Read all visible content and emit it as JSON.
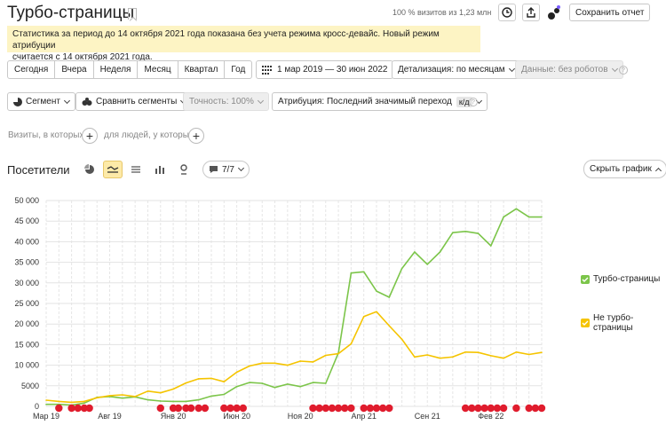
{
  "header": {
    "title": "Турбо-страницы",
    "visits_share": "100 % визитов из 1,23 млн",
    "save_report": "Сохранить отчет"
  },
  "notice": {
    "line1": "Статистика за период до 14 октября 2021 года показана без учета режима кросс-девайс. Новый режим атрибуции",
    "line2": "считается с 14 октября 2021 года."
  },
  "periods": [
    "Сегодня",
    "Вчера",
    "Неделя",
    "Месяц",
    "Квартал",
    "Год"
  ],
  "date_range": "1 мар 2019 — 30 июн 2022",
  "detail": "Детализация: по месяцам",
  "data_filter": "Данные: без роботов",
  "segment": "Сегмент",
  "compare": "Сравнить сегменты",
  "accuracy": "Точность: 100%",
  "attribution": "Атрибуция: Последний значимый переход",
  "attribution_badge": "к/д",
  "visits_who": "Визиты, в которых",
  "people_who": "для людей, у которых",
  "chart_section": {
    "title": "Посетители",
    "metrics_badge": "7/7",
    "hide_chart": "Скрыть график"
  },
  "chart_data": {
    "type": "line",
    "x": [
      "2019-03",
      "2019-04",
      "2019-05",
      "2019-06",
      "2019-07",
      "2019-08",
      "2019-09",
      "2019-10",
      "2019-11",
      "2019-12",
      "2020-01",
      "2020-02",
      "2020-03",
      "2020-04",
      "2020-05",
      "2020-06",
      "2020-07",
      "2020-08",
      "2020-09",
      "2020-10",
      "2020-11",
      "2020-12",
      "2021-01",
      "2021-02",
      "2021-03",
      "2021-04",
      "2021-05",
      "2021-06",
      "2021-07",
      "2021-08",
      "2021-09",
      "2021-10",
      "2021-11",
      "2021-12",
      "2022-01",
      "2022-02",
      "2022-03",
      "2022-04",
      "2022-05",
      "2022-06"
    ],
    "x_ticks": [
      "Мар 19",
      "Авг 19",
      "Янв 20",
      "Июн 20",
      "Ноя 20",
      "Апр 21",
      "Сен 21",
      "Фев 22"
    ],
    "y_ticks": [
      "0",
      "5000",
      "10 000",
      "15 000",
      "20 000",
      "25 000",
      "30 000",
      "35 000",
      "40 000",
      "45 000",
      "50 000"
    ],
    "ylim": [
      0,
      50000
    ],
    "series": [
      {
        "name": "Турбо-страницы",
        "color": "#7cc54a",
        "values": [
          500,
          500,
          300,
          800,
          2200,
          2400,
          2000,
          2300,
          1600,
          1300,
          1200,
          1200,
          1600,
          2500,
          2900,
          4800,
          5800,
          5600,
          4600,
          5400,
          4800,
          5800,
          5600,
          13000,
          32400,
          32700,
          28000,
          26500,
          33500,
          37500,
          34500,
          37500,
          42200,
          42500,
          42000,
          39000,
          46000,
          48000,
          46000,
          46000
        ]
      },
      {
        "name": "Не турбо-страницы",
        "color": "#f5c400",
        "values": [
          1500,
          1200,
          1000,
          1200,
          2100,
          2600,
          2800,
          2400,
          3700,
          3300,
          4200,
          5700,
          6700,
          6800,
          6000,
          8300,
          9800,
          10500,
          10500,
          10000,
          11000,
          10800,
          12400,
          12800,
          15200,
          21800,
          23000,
          19600,
          16300,
          12000,
          12500,
          11700,
          12000,
          13200,
          13100,
          12300,
          11700,
          13200,
          12600,
          13100
        ]
      }
    ],
    "grid": true,
    "legend": "right"
  }
}
